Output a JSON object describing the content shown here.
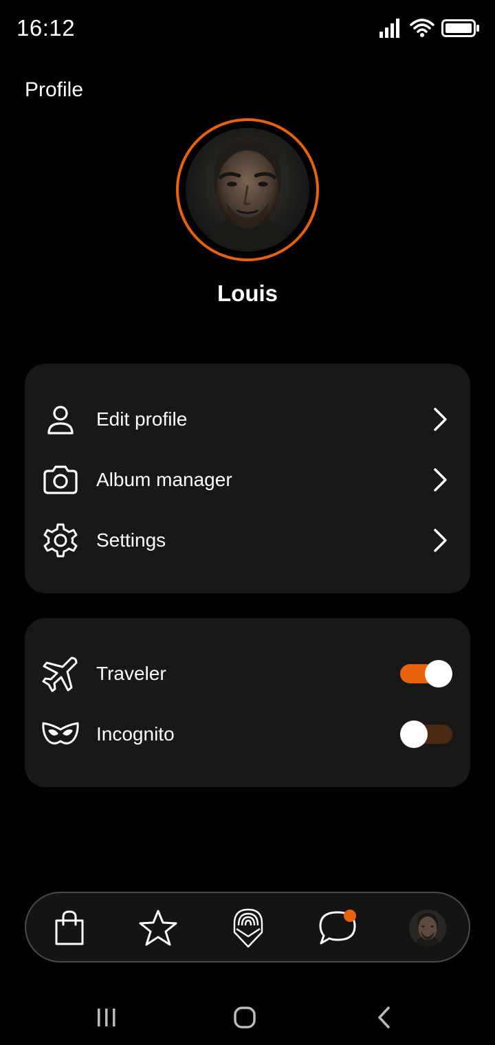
{
  "status_bar": {
    "time": "16:12",
    "icons": [
      "signal-icon",
      "wifi-icon",
      "battery-icon"
    ]
  },
  "page": {
    "title": "Profile"
  },
  "profile": {
    "name": "Louis",
    "avatar": "avatar-photo"
  },
  "menu": {
    "items": [
      {
        "label": "Edit profile",
        "icon": "user-icon"
      },
      {
        "label": "Album manager",
        "icon": "camera-icon"
      },
      {
        "label": "Settings",
        "icon": "gear-icon"
      }
    ]
  },
  "toggles": {
    "items": [
      {
        "label": "Traveler",
        "icon": "airplane-icon",
        "on": true
      },
      {
        "label": "Incognito",
        "icon": "mask-icon",
        "on": false
      }
    ]
  },
  "bottom_nav": {
    "items": [
      "shopping-bag-icon",
      "star-icon",
      "badge-shield-icon",
      "chat-bubble-icon",
      "profile-avatar"
    ],
    "notification_on": "chat-bubble-icon"
  },
  "colors": {
    "accent": "#e8620c",
    "background": "#000000",
    "card": "#181818",
    "toggle_off_track": "#4a2a14"
  }
}
